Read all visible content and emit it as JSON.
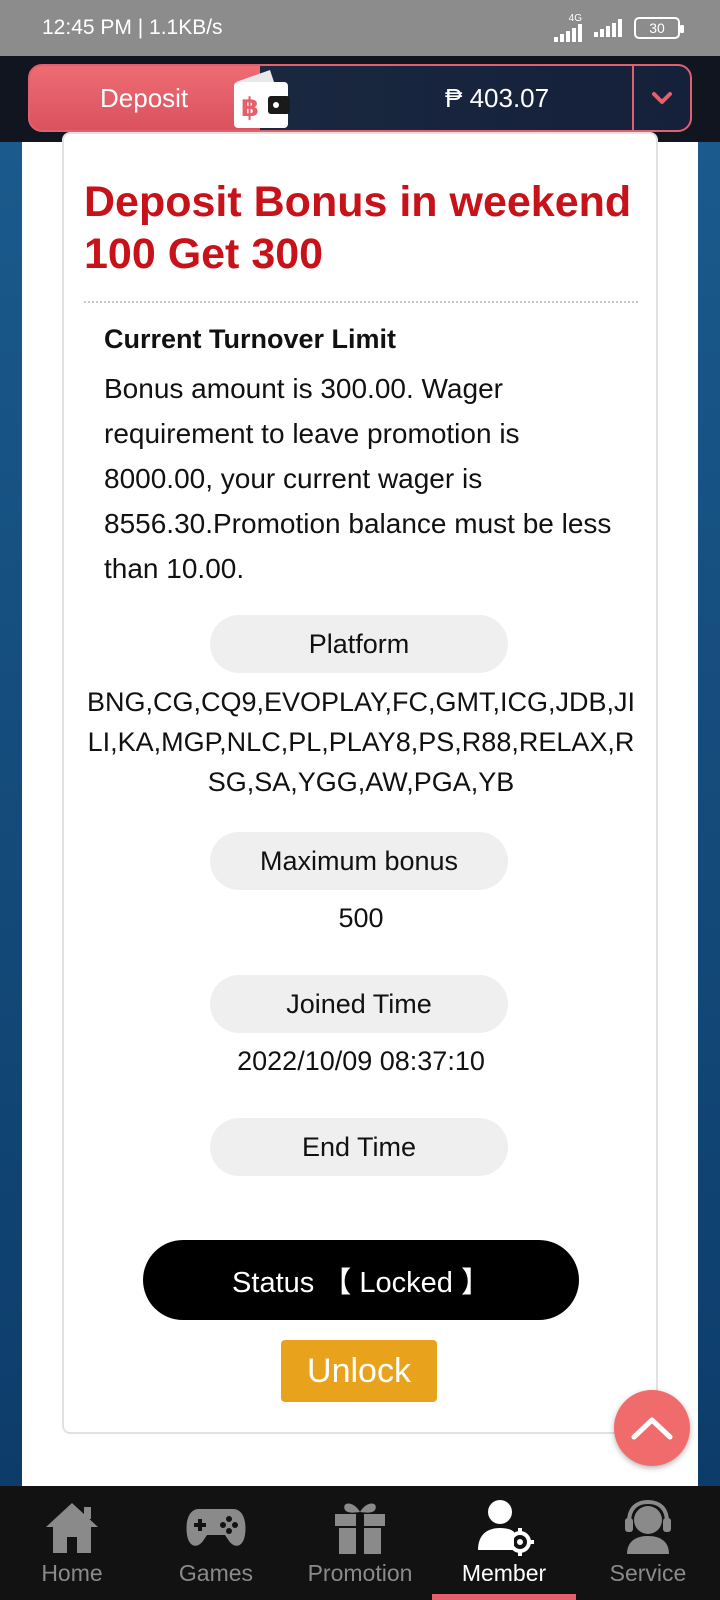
{
  "status_bar": {
    "time": "12:45 PM",
    "speed": "1.1KB/s",
    "network": "4G",
    "battery": "30"
  },
  "header": {
    "deposit_label": "Deposit",
    "balance": "₱ 403.07"
  },
  "promotion": {
    "title": "Deposit Bonus in weekend 100 Get 300",
    "section_heading": "Current Turnover Limit",
    "description": "Bonus amount is 300.00. Wager requirement to leave promotion is 8000.00, your current wager is 8556.30.Promotion balance must be less than 10.00.",
    "platform_label": "Platform",
    "platform_value": "BNG,CG,CQ9,EVOPLAY,FC,GMT,ICG,JDB,JILI,KA,MGP,NLC,PL,PLAY8,PS,R88,RELAX,RSG,SA,YGG,AW,PGA,YB",
    "max_bonus_label": "Maximum bonus",
    "max_bonus_value": "500",
    "joined_label": "Joined Time",
    "joined_value": "2022/10/09 08:37:10",
    "end_label": "End Time",
    "status_text": "Status 【 Locked 】",
    "unlock_label": "Unlock"
  },
  "nav": {
    "home": "Home",
    "games": "Games",
    "promotion": "Promotion",
    "member": "Member",
    "service": "Service",
    "active": "member"
  },
  "colors": {
    "title_red": "#c8121a",
    "deposit_pink": "#e5606a",
    "unlock_orange": "#e8a21c",
    "scroll_top": "#f06b6b"
  }
}
